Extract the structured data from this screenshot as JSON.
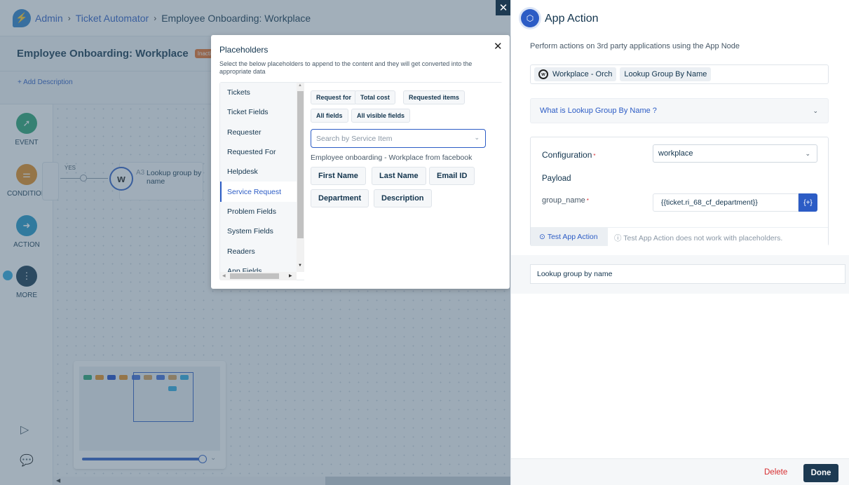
{
  "breadcrumb": {
    "items": [
      "Admin",
      "Ticket Automator"
    ],
    "current": "Employee Onboarding: Workplace"
  },
  "workflow": {
    "title": "Employee Onboarding: Workplace",
    "status_badge": "Inactive",
    "add_description": "+ Add Description"
  },
  "toolbox": {
    "items": [
      {
        "label": "EVENT",
        "icon": "event-cursor-icon",
        "color": "#27a270"
      },
      {
        "label": "CONDITION",
        "icon": "condition-toggle-icon",
        "color": "#e48a1b"
      },
      {
        "label": "ACTION",
        "icon": "action-arrow-icon",
        "color": "#1c95c7"
      },
      {
        "label": "MORE",
        "icon": "more-dots-icon",
        "color": "#12344d"
      }
    ]
  },
  "canvas": {
    "branch_label": "YES",
    "node": {
      "id": "A3",
      "label": "Lookup group by name"
    }
  },
  "minimap": {
    "zoom_fraction": 1.0
  },
  "placeholders": {
    "title": "Placeholders",
    "description": "Select the below placeholders to append to the content and they will get converted into the appropriate data",
    "categories": [
      "Tickets",
      "Ticket Fields",
      "Requester",
      "Requested For",
      "Helpdesk",
      "Service Request",
      "Problem Fields",
      "System Fields",
      "Readers",
      "App Fields"
    ],
    "active_category": "Service Request",
    "top_chips": [
      "Request for",
      "Total cost",
      "Requested items",
      "All fields",
      "All visible fields"
    ],
    "search_placeholder": "Search by Service Item",
    "service_item_title": "Employee onboarding - Workplace from facebook",
    "field_chips": [
      "First Name",
      "Last Name",
      "Email ID",
      "Department",
      "Description"
    ]
  },
  "app_action": {
    "title": "App Action",
    "description": "Perform actions on 3rd party applications using the App Node",
    "app_tag": "Workplace - Orch",
    "action_tag": "Lookup Group By Name",
    "accordion_label": "What is Lookup Group By Name ?",
    "configuration_label": "Configuration",
    "configuration_value": "workplace",
    "payload_label": "Payload",
    "group_name_label": "group_name",
    "group_name_value": "{{ticket.ri_68_cf_department}}",
    "placeholder_button": "{+}",
    "test_button": "Test App Action",
    "test_note": "Test App Action does not work with placeholders.",
    "node_name": "Lookup group by name",
    "delete_label": "Delete",
    "done_label": "Done"
  }
}
